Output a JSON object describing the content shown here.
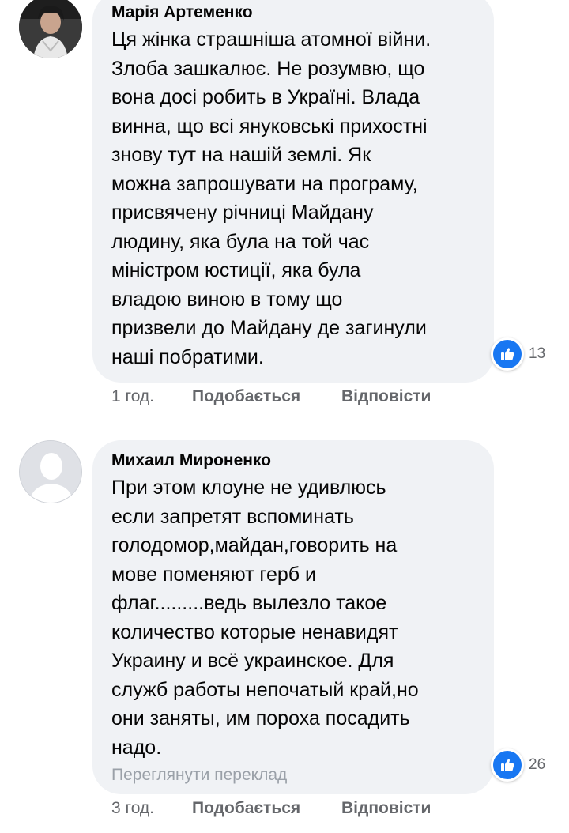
{
  "comments": [
    {
      "author": "Марія Артеменко",
      "text": "Ця жінка страшніша атомної війни.\nЗлоба зашкалює. Не розумвю, що\nвона досі робить в Україні. Влада\nвинна, що всі януковські прихостні\nзнову тут на нашій землі. Як\nможна запрошувати на програму,\nприсвячену річниці Майдану\nлюдину, яка була на той час\nміністром юстиції, яка була\nвладою виною в тому що\nпризвели до Майдану де загинули\nнаші побратими.",
      "reactions_count": "13",
      "time": "1 год.",
      "like_label": "Подобається",
      "reply_label": "Відповісти"
    },
    {
      "author": "Михаил Мироненко",
      "text": "При этом клоуне не удивлюсь\nесли запретят вспоминать\nголодомор,майдан,говорить на\nмове поменяют герб и\nфлаг.........ведь вылезло такое\nколичество  которые ненавидят\nУкраину и всё украинское. Для\nслужб работы непочатый край,но\nони заняты, им пороха посадить\nнадо.",
      "translate_label": "Переглянути переклад",
      "reactions_count": "26",
      "time": "3 год.",
      "like_label": "Подобається",
      "reply_label": "Відповісти"
    }
  ],
  "colors": {
    "bubble": "#f0f2f5",
    "like_blue": "#1877f2",
    "meta_gray": "#65676b"
  },
  "icons": {
    "reaction": "thumbs-up-icon",
    "default_avatar": "person-silhouette-icon"
  }
}
